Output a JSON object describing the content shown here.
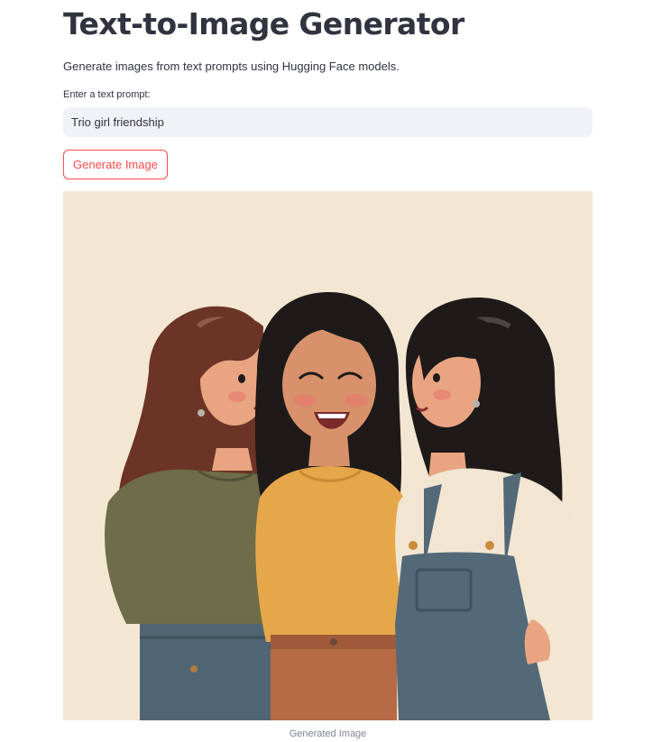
{
  "app": {
    "title": "Text-to-Image Generator",
    "subtitle": "Generate images from text prompts using Hugging Face models."
  },
  "prompt": {
    "label": "Enter a text prompt:",
    "value": "Trio girl friendship"
  },
  "generate_button": {
    "label": "Generate Image"
  },
  "output": {
    "caption": "Generated Image"
  },
  "colors": {
    "accent": "#ff4b4b",
    "input_bg": "#f0f2f6",
    "text": "#31333f",
    "caption": "#808495",
    "image_bg": "#f3e7d3"
  }
}
